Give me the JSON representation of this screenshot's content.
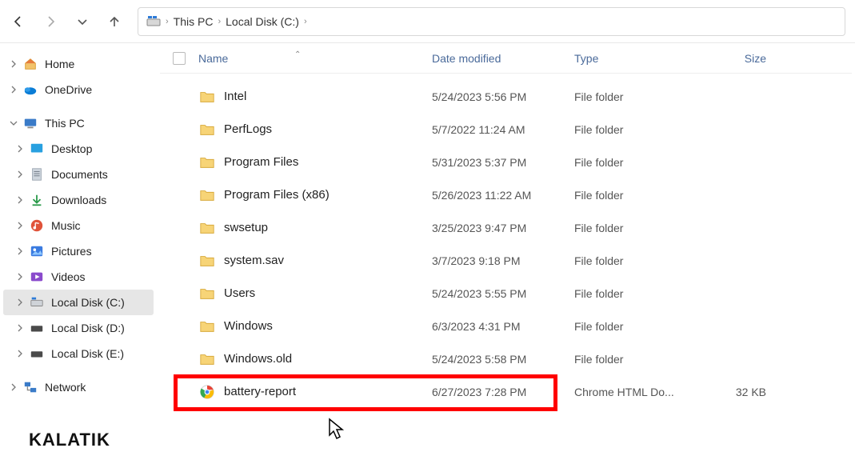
{
  "breadcrumb": {
    "seg1": "This PC",
    "seg2": "Local Disk (C:)"
  },
  "columns": {
    "name": "Name",
    "date": "Date modified",
    "type": "Type",
    "size": "Size"
  },
  "sidebar": {
    "home": "Home",
    "onedrive": "OneDrive",
    "thispc": "This PC",
    "desktop": "Desktop",
    "documents": "Documents",
    "downloads": "Downloads",
    "music": "Music",
    "pictures": "Pictures",
    "videos": "Videos",
    "localc": "Local Disk (C:)",
    "locald": "Local Disk (D:)",
    "locale": "Local Disk (E:)",
    "network": "Network"
  },
  "files": [
    {
      "name": "Intel",
      "date": "5/24/2023 5:56 PM",
      "type": "File folder",
      "size": "",
      "icon": "folder"
    },
    {
      "name": "PerfLogs",
      "date": "5/7/2022 11:24 AM",
      "type": "File folder",
      "size": "",
      "icon": "folder"
    },
    {
      "name": "Program Files",
      "date": "5/31/2023 5:37 PM",
      "type": "File folder",
      "size": "",
      "icon": "folder"
    },
    {
      "name": "Program Files (x86)",
      "date": "5/26/2023 11:22 AM",
      "type": "File folder",
      "size": "",
      "icon": "folder"
    },
    {
      "name": "swsetup",
      "date": "3/25/2023 9:47 PM",
      "type": "File folder",
      "size": "",
      "icon": "folder"
    },
    {
      "name": "system.sav",
      "date": "3/7/2023 9:18 PM",
      "type": "File folder",
      "size": "",
      "icon": "folder"
    },
    {
      "name": "Users",
      "date": "5/24/2023 5:55 PM",
      "type": "File folder",
      "size": "",
      "icon": "folder"
    },
    {
      "name": "Windows",
      "date": "6/3/2023 4:31 PM",
      "type": "File folder",
      "size": "",
      "icon": "folder"
    },
    {
      "name": "Windows.old",
      "date": "5/24/2023 5:58 PM",
      "type": "File folder",
      "size": "",
      "icon": "folder"
    },
    {
      "name": "battery-report",
      "date": "6/27/2023 7:28 PM",
      "type": "Chrome HTML Do...",
      "size": "32 KB",
      "icon": "chrome"
    }
  ],
  "watermark": "KALATIK"
}
